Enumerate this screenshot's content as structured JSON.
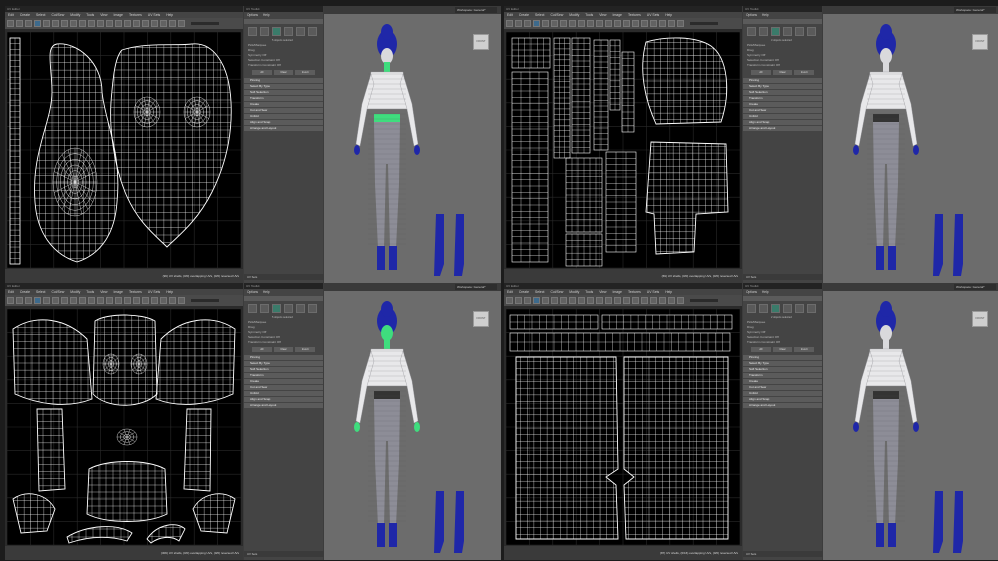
{
  "quads": [
    {
      "uv_title": "UV Editor",
      "menu": [
        "Edit",
        "Create",
        "Select",
        "Cut/Sew",
        "Modify",
        "Tools",
        "View",
        "Image",
        "Textures",
        "UV Sets",
        "Help"
      ],
      "status": "(96) UV shells, (0/0) overlapping UVs, (0/0) reversed UVs",
      "toolkit": {
        "title": "UV Toolkit",
        "tabs": [
          "Options",
          "Help"
        ],
        "selected_count": "5 objects selected",
        "mode": "Pick/Marquee",
        "drag": "Drag",
        "symmetry": "Symmetry",
        "symmetry_value": "Off",
        "selection_constraint": "Selection Constraint",
        "selection_constraint_value": "Off",
        "transform_constraint": "Transform Constraint",
        "transform_constraint_value": "Off",
        "buttons": [
          "All",
          "Clear",
          "Invert"
        ],
        "sections": [
          "Pinning",
          "Select By Type",
          "Soft Selection",
          "Transform",
          "Create",
          "Cut and Sew",
          "Unfold",
          "Align and Snap",
          "Arrange and Layout"
        ],
        "footer": "UV Sets"
      },
      "viewport": {
        "workspace": "Workspace:",
        "workspace_value": "General*",
        "cube": "FRONT"
      },
      "colors": {
        "selection": "#3fdd7e"
      }
    },
    {
      "uv_title": "UV Editor",
      "menu": [
        "Edit",
        "Create",
        "Select",
        "Cut/Sew",
        "Modify",
        "Tools",
        "View",
        "Image",
        "Textures",
        "UV Sets",
        "Help"
      ],
      "status": "(69) UV shells, (0/0) overlapping UVs, (0/0) reversed UVs",
      "toolkit": {
        "title": "UV Toolkit",
        "tabs": [
          "Options",
          "Help"
        ],
        "selected_count": "3 objects selected",
        "mode": "Pick/Marquee",
        "drag": "Drag",
        "symmetry": "Symmetry",
        "symmetry_value": "Off",
        "selection_constraint": "Selection Constraint",
        "selection_constraint_value": "Off",
        "transform_constraint": "Transform Constraint",
        "transform_constraint_value": "Off",
        "buttons": [
          "All",
          "Clear",
          "Invert"
        ],
        "sections": [
          "Pinning",
          "Select By Type",
          "Soft Selection",
          "Transform",
          "Create",
          "Cut and Sew",
          "Unfold",
          "Align and Snap",
          "Arrange and Layout"
        ],
        "footer": "UV Sets"
      },
      "viewport": {
        "workspace": "Workspace:",
        "workspace_value": "General*",
        "cube": "FRONT"
      },
      "colors": {
        "selection": "#d8d8d8"
      }
    },
    {
      "uv_title": "UV Editor",
      "menu": [
        "Edit",
        "Create",
        "Select",
        "Cut/Sew",
        "Modify",
        "Tools",
        "View",
        "Image",
        "Textures",
        "UV Sets",
        "Help"
      ],
      "status": "(306) UV shells, (0/0) overlapping UVs, (0/0) reversed UVs",
      "toolkit": {
        "title": "UV Toolkit",
        "tabs": [
          "Options",
          "Help"
        ],
        "selected_count": "5 objects selected",
        "mode": "Pick/Marquee",
        "drag": "Drag",
        "symmetry": "Symmetry",
        "symmetry_value": "Off",
        "selection_constraint": "Selection Constraint",
        "selection_constraint_value": "Off",
        "transform_constraint": "Transform Constraint",
        "transform_constraint_value": "Off",
        "buttons": [
          "All",
          "Clear",
          "Invert"
        ],
        "sections": [
          "Pinning",
          "Select By Type",
          "Soft Selection",
          "Transform",
          "Create",
          "Cut and Sew",
          "Unfold",
          "Align and Snap",
          "Arrange and Layout"
        ],
        "footer": "UV Sets"
      },
      "viewport": {
        "workspace": "Workspace:",
        "workspace_value": "General*",
        "cube": "FRONT"
      },
      "colors": {
        "selection": "#3fdd7e"
      }
    },
    {
      "uv_title": "UV Editor",
      "menu": [
        "Edit",
        "Create",
        "Select",
        "Cut/Sew",
        "Modify",
        "Tools",
        "View",
        "Image",
        "Textures",
        "UV Sets",
        "Help"
      ],
      "status": "(87) UV shells, (0/16) overlapping UVs, (0/0) reversed UVs",
      "toolkit": {
        "title": "UV Toolkit",
        "tabs": [
          "Options",
          "Help"
        ],
        "selected_count": "2 objects selected",
        "mode": "Pick/Marquee",
        "drag": "Drag",
        "symmetry": "Symmetry",
        "symmetry_value": "Off",
        "selection_constraint": "Selection Constraint",
        "selection_constraint_value": "Off",
        "transform_constraint": "Transform Constraint",
        "transform_constraint_value": "Off",
        "buttons": [
          "All",
          "Clear",
          "Invert"
        ],
        "sections": [
          "Pinning",
          "Select By Type",
          "Soft Selection",
          "Transform",
          "Create",
          "Cut and Sew",
          "Unfold",
          "Align and Snap",
          "Arrange and Layout"
        ],
        "footer": "UV Sets"
      },
      "viewport": {
        "workspace": "Workspace:",
        "workspace_value": "General*",
        "cube": "FRONT"
      },
      "colors": {
        "selection": "#d8d8d8"
      }
    }
  ]
}
